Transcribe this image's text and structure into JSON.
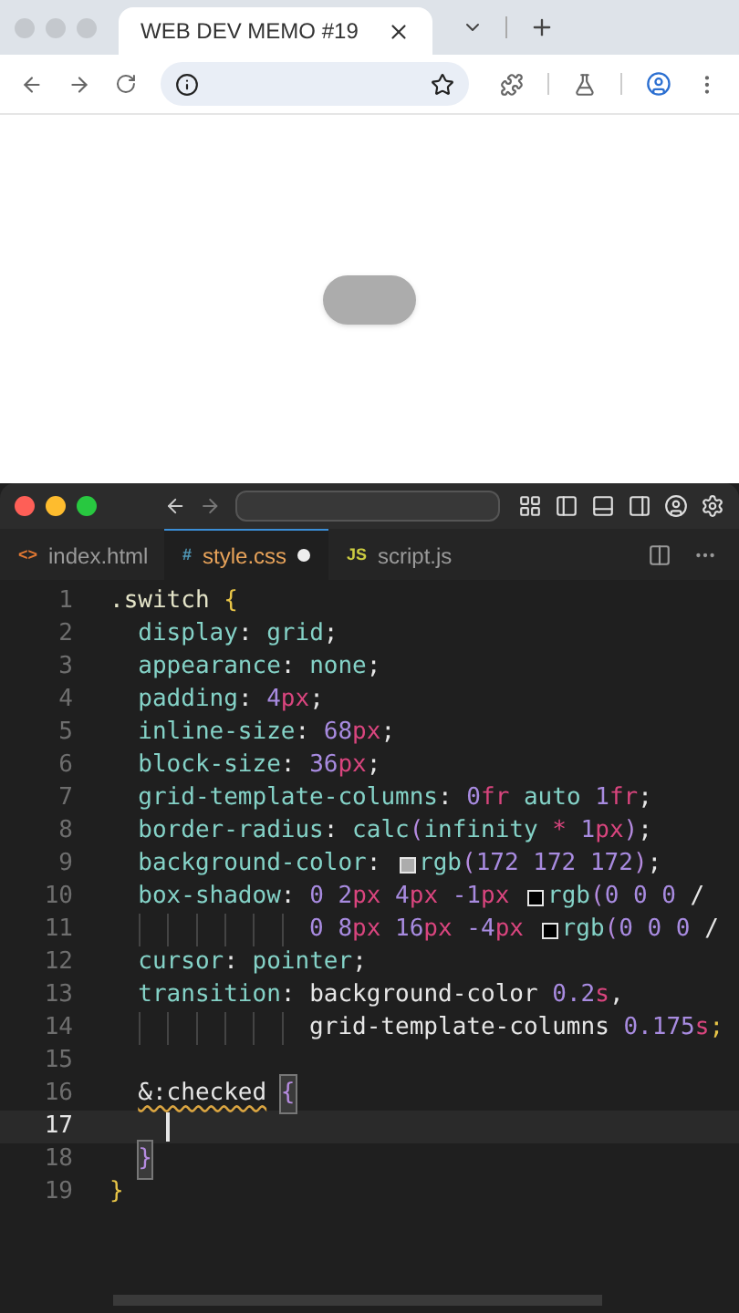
{
  "browser": {
    "tabs": [
      {
        "title": "WEB DEV MEMO #19",
        "selected": true
      }
    ]
  },
  "page": {
    "switch": {
      "checked": false
    }
  },
  "editor": {
    "file_tabs": [
      {
        "badge": "<>",
        "label": "index.html",
        "color": "#e37933",
        "selected": false,
        "modified": false
      },
      {
        "badge": "#",
        "label": "style.css",
        "color": "#519aba",
        "selected": true,
        "modified": true
      },
      {
        "badge": "JS",
        "label": "script.js",
        "color": "#cbcb41",
        "selected": false,
        "modified": false
      }
    ],
    "lines": [
      {
        "number": "1",
        "current": false,
        "caret": false,
        "tokens": [
          {
            "text": ".switch ",
            "kind": "sel"
          },
          {
            "text": "{",
            "kind": "brace"
          }
        ],
        "children": [
          {
            "number": "2",
            "current": false,
            "caret": false,
            "tokens": [
              {
                "text": "display",
                "kind": "prop"
              },
              {
                "text": ": ",
                "kind": "plain"
              },
              {
                "text": "grid",
                "kind": "prop"
              },
              {
                "text": ";",
                "kind": "plain"
              }
            ]
          },
          {
            "number": "3",
            "current": false,
            "caret": false,
            "tokens": [
              {
                "text": "appearance",
                "kind": "prop"
              },
              {
                "text": ": ",
                "kind": "plain"
              },
              {
                "text": "none",
                "kind": "prop"
              },
              {
                "text": ";",
                "kind": "plain"
              }
            ]
          },
          {
            "number": "4",
            "current": false,
            "caret": false,
            "tokens": [
              {
                "text": "padding",
                "kind": "prop"
              },
              {
                "text": ": ",
                "kind": "plain"
              },
              {
                "text": "4",
                "kind": "num"
              },
              {
                "text": "px",
                "kind": "unit"
              },
              {
                "text": ";",
                "kind": "plain"
              }
            ]
          },
          {
            "number": "5",
            "current": false,
            "caret": false,
            "tokens": [
              {
                "text": "inline-size",
                "kind": "prop"
              },
              {
                "text": ": ",
                "kind": "plain"
              },
              {
                "text": "68",
                "kind": "num"
              },
              {
                "text": "px",
                "kind": "unit"
              },
              {
                "text": ";",
                "kind": "plain"
              }
            ]
          },
          {
            "number": "6",
            "current": false,
            "caret": false,
            "tokens": [
              {
                "text": "block-size",
                "kind": "prop"
              },
              {
                "text": ": ",
                "kind": "plain"
              },
              {
                "text": "36",
                "kind": "num"
              },
              {
                "text": "px",
                "kind": "unit"
              },
              {
                "text": ";",
                "kind": "plain"
              }
            ]
          },
          {
            "number": "7",
            "current": false,
            "caret": false,
            "tokens": [
              {
                "text": "grid-template-columns",
                "kind": "prop"
              },
              {
                "text": ": ",
                "kind": "plain"
              },
              {
                "text": "0",
                "kind": "num"
              },
              {
                "text": "fr",
                "kind": "unit"
              },
              {
                "text": " auto ",
                "kind": "prop"
              },
              {
                "text": "1",
                "kind": "num"
              },
              {
                "text": "fr",
                "kind": "unit"
              },
              {
                "text": ";",
                "kind": "plain"
              }
            ]
          },
          {
            "number": "8",
            "current": false,
            "caret": false,
            "tokens": [
              {
                "text": "border-radius",
                "kind": "prop"
              },
              {
                "text": ": ",
                "kind": "plain"
              },
              {
                "text": "calc",
                "kind": "prop"
              },
              {
                "text": "(",
                "kind": "paren"
              },
              {
                "text": "infinity ",
                "kind": "prop"
              },
              {
                "text": "*",
                "kind": "unit"
              },
              {
                "text": " 1",
                "kind": "num"
              },
              {
                "text": "px",
                "kind": "unit"
              },
              {
                "text": ")",
                "kind": "paren"
              },
              {
                "text": ";",
                "kind": "plain"
              }
            ]
          },
          {
            "number": "9",
            "current": false,
            "caret": false,
            "tokens": [
              {
                "text": "background-color",
                "kind": "prop"
              },
              {
                "text": ": ",
                "kind": "plain"
              },
              {
                "kind": "swatch",
                "color": "#acacac"
              },
              {
                "text": "rgb",
                "kind": "prop"
              },
              {
                "text": "(",
                "kind": "paren"
              },
              {
                "text": "172 172 172",
                "kind": "num"
              },
              {
                "text": ")",
                "kind": "paren"
              },
              {
                "text": ";",
                "kind": "plain"
              }
            ]
          },
          {
            "number": "10",
            "current": false,
            "caret": false,
            "tokens": [
              {
                "text": "box-shadow",
                "kind": "prop"
              },
              {
                "text": ": ",
                "kind": "plain"
              },
              {
                "text": "0 2",
                "kind": "num"
              },
              {
                "text": "px",
                "kind": "unit"
              },
              {
                "text": " 4",
                "kind": "num"
              },
              {
                "text": "px",
                "kind": "unit"
              },
              {
                "text": " -1",
                "kind": "num"
              },
              {
                "text": "px ",
                "kind": "unit"
              },
              {
                "kind": "swatch",
                "color": "#000000"
              },
              {
                "text": "rgb",
                "kind": "prop"
              },
              {
                "text": "(",
                "kind": "paren"
              },
              {
                "text": "0 0 0 ",
                "kind": "num"
              },
              {
                "text": "/",
                "kind": "plain"
              }
            ]
          },
          {
            "number": "11",
            "current": false,
            "caret": false,
            "continuation": true,
            "tokens": [
              {
                "text": "0 8",
                "kind": "num"
              },
              {
                "text": "px",
                "kind": "unit"
              },
              {
                "text": " 16",
                "kind": "num"
              },
              {
                "text": "px",
                "kind": "unit"
              },
              {
                "text": " -4",
                "kind": "num"
              },
              {
                "text": "px ",
                "kind": "unit"
              },
              {
                "kind": "swatch",
                "color": "#000000"
              },
              {
                "text": "rgb",
                "kind": "prop"
              },
              {
                "text": "(",
                "kind": "paren"
              },
              {
                "text": "0 0 0 ",
                "kind": "num"
              },
              {
                "text": "/",
                "kind": "plain"
              }
            ]
          },
          {
            "number": "12",
            "current": false,
            "caret": false,
            "tokens": [
              {
                "text": "cursor",
                "kind": "prop"
              },
              {
                "text": ": ",
                "kind": "plain"
              },
              {
                "text": "pointer",
                "kind": "prop"
              },
              {
                "text": ";",
                "kind": "plain"
              }
            ]
          },
          {
            "number": "13",
            "current": false,
            "caret": false,
            "tokens": [
              {
                "text": "transition",
                "kind": "prop"
              },
              {
                "text": ": ",
                "kind": "plain"
              },
              {
                "text": "background-color ",
                "kind": "plain"
              },
              {
                "text": "0.2",
                "kind": "num"
              },
              {
                "text": "s",
                "kind": "unit"
              },
              {
                "text": ",",
                "kind": "plain"
              }
            ]
          },
          {
            "number": "14",
            "current": false,
            "caret": false,
            "continuation": true,
            "tokens": [
              {
                "text": "grid-template-columns ",
                "kind": "plain"
              },
              {
                "text": "0.175",
                "kind": "num"
              },
              {
                "text": "s",
                "kind": "unit"
              },
              {
                "text": ";",
                "kind": "brace"
              }
            ]
          },
          {
            "number": "15",
            "current": false,
            "caret": false
          },
          {
            "number": "16",
            "current": false,
            "caret": false,
            "tokens": [
              {
                "text": "&:checked",
                "kind": "plain",
                "squiggle": true
              },
              {
                "text": "{",
                "kind": "paren",
                "matched": true
              }
            ],
            "children": [
              {
                "number": "17",
                "current": true,
                "caret": true
              }
            ]
          },
          {
            "number": "18",
            "current": false,
            "caret": false,
            "tokens": [
              {
                "text": "}",
                "kind": "paren",
                "matched": true
              }
            ]
          }
        ]
      },
      {
        "number": "19",
        "current": false,
        "caret": false,
        "tokens": [
          {
            "text": "}",
            "kind": "brace"
          }
        ]
      }
    ]
  }
}
